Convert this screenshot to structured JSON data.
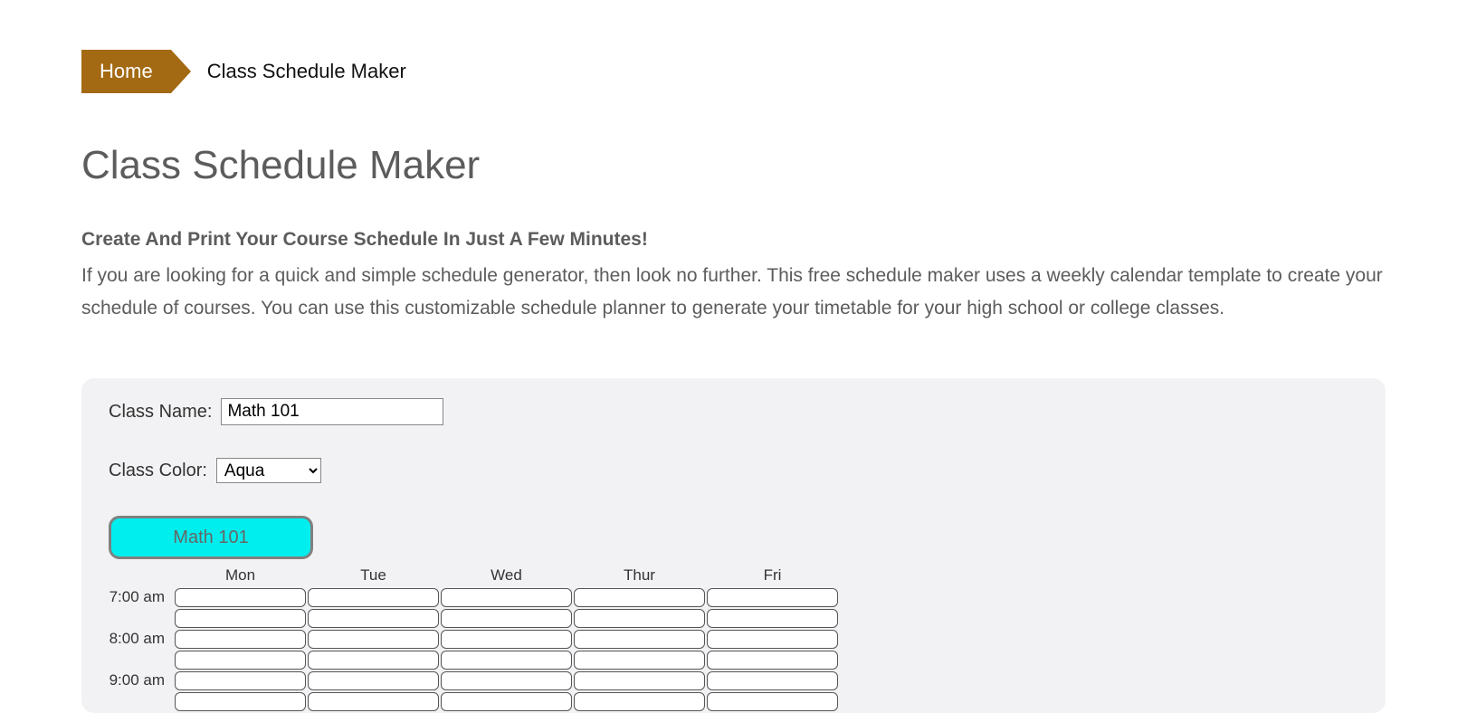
{
  "breadcrumb": {
    "home": "Home",
    "current": "Class Schedule Maker"
  },
  "title": "Class Schedule Maker",
  "subhead": "Create And Print Your Course Schedule In Just A Few Minutes!",
  "description": "If you are looking for a quick and simple schedule generator, then look no further. This free schedule maker uses a weekly calendar template to create your schedule of courses. You can use this customizable schedule planner to generate your timetable for your high school or college classes.",
  "form": {
    "class_name_label": "Class Name:",
    "class_name_value": "Math 101",
    "class_color_label": "Class Color:",
    "class_color_value": "Aqua"
  },
  "chip": {
    "label": "Math 101",
    "color_hex": "#00eeee"
  },
  "schedule": {
    "days": [
      "Mon",
      "Tue",
      "Wed",
      "Thur",
      "Fri"
    ],
    "times": [
      "7:00 am",
      "8:00 am",
      "9:00 am"
    ]
  }
}
